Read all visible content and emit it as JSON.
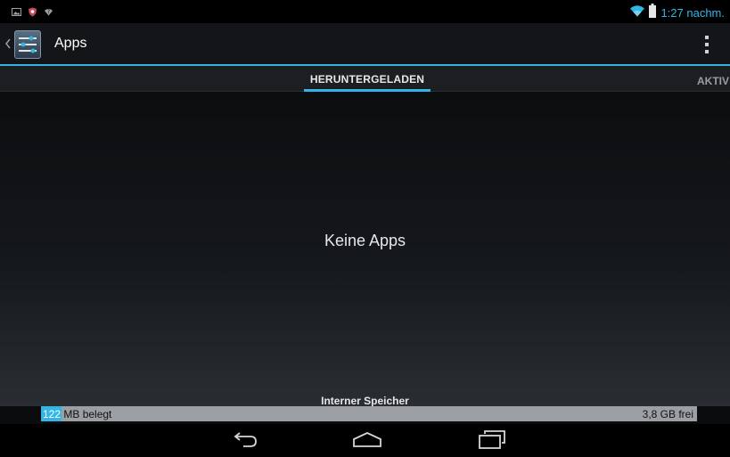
{
  "status_bar": {
    "left_icons": [
      "gallery-icon",
      "shield-icon",
      "wifi-question-icon"
    ],
    "right_icons": [
      "wifi-icon",
      "battery-icon"
    ],
    "time": "1:27 nachm.",
    "accent": "#33b5e5"
  },
  "action_bar": {
    "title": "Apps",
    "icon": "settings-sliders-icon",
    "menu_icon": "overflow-menu-icon"
  },
  "tabs": [
    {
      "label": "HERUNTERGELADEN",
      "selected": true
    },
    {
      "label": "AKTIV",
      "selected": false
    }
  ],
  "content": {
    "empty_text": "Keine Apps"
  },
  "storage": {
    "title": "Interner Speicher",
    "used_number": "122",
    "used_label": " MB belegt",
    "free_label": "3,8 GB frei",
    "used_fraction": 0.031,
    "used_color": "#33b5e5",
    "bar_color": "#9c9fa3"
  },
  "nav_bar": {
    "buttons": [
      "back-icon",
      "home-icon",
      "recents-icon"
    ]
  }
}
